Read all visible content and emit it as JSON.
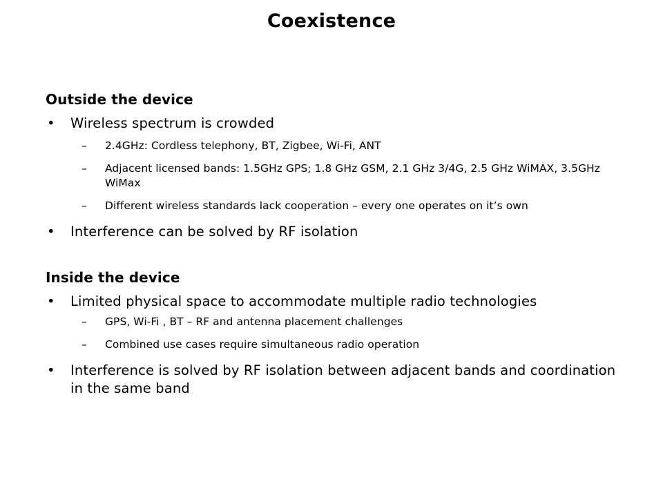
{
  "slide": {
    "title": "Coexistence",
    "sections": [
      {
        "header": "Outside the device",
        "items": [
          {
            "level": 1,
            "marker": "•",
            "text": "Wireless spectrum is crowded"
          },
          {
            "level": 2,
            "marker": "–",
            "text": "2.4GHz: Cordless telephony, BT, Zigbee, Wi-Fi, ANT"
          },
          {
            "level": 2,
            "marker": "–",
            "text": "Adjacent licensed bands: 1.5GHz GPS; 1.8 GHz GSM, 2.1 GHz 3/4G, 2.5 GHz WiMAX, 3.5GHz WiMax"
          },
          {
            "level": 2,
            "marker": "–",
            "text": "Different wireless standards lack cooperation – every one operates on it’s own"
          },
          {
            "level": 1,
            "marker": "•",
            "text": "Interference can be solved by RF isolation"
          }
        ]
      },
      {
        "header": "Inside the device",
        "items": [
          {
            "level": 1,
            "marker": "•",
            "text": "Limited physical space to accommodate multiple radio technologies"
          },
          {
            "level": 2,
            "marker": "–",
            "text": "GPS, Wi-Fi , BT – RF and antenna placement challenges"
          },
          {
            "level": 2,
            "marker": "–",
            "text": "Combined use cases require simultaneous radio operation"
          },
          {
            "level": 1,
            "marker": "•",
            "text": "Interference is solved by RF isolation between adjacent bands and coordination in the same band"
          }
        ]
      }
    ]
  },
  "colors": {
    "background": "#ffffff",
    "text": "#000000"
  }
}
